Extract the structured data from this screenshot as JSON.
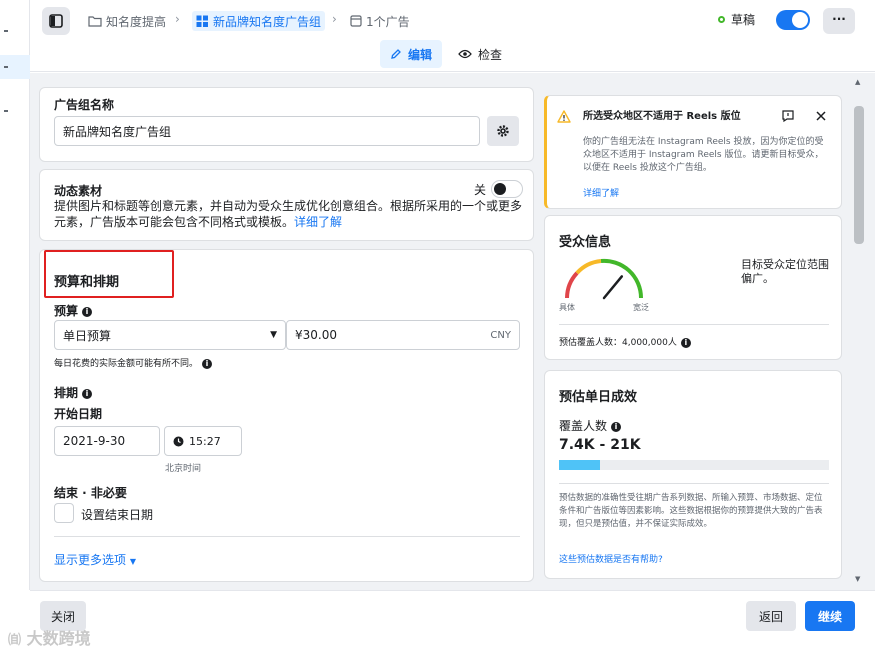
{
  "breadcrumb": {
    "campaign": "知名度提高",
    "adset": "新品牌知名度广告组",
    "ads": "1个广告"
  },
  "status": {
    "draft_label": "草稿"
  },
  "more_label": "···",
  "tabs": {
    "edit": "编辑",
    "review": "检查"
  },
  "adset_name": {
    "label": "广告组名称",
    "value": "新品牌知名度广告组"
  },
  "dynamic_creative": {
    "title": "动态素材",
    "toggle_label": "关",
    "description": "提供图片和标题等创意元素，并自动为受众生成优化创意组合。根据所采用的一个或更多元素，广告版本可能会包含不同格式或模板。",
    "learn_more": "详细了解"
  },
  "budget_schedule": {
    "section_title": "预算和排期",
    "budget_label": "预算",
    "budget_type": "单日预算",
    "budget_amount": "¥30.00",
    "currency": "CNY",
    "budget_note": "每日花费的实际金额可能有所不同。",
    "schedule_label": "排期",
    "start_date_label": "开始日期",
    "start_date": "2021-9-30",
    "start_time": "15:27",
    "timezone": "北京时间",
    "end_label": "结束 · 非必要",
    "end_checkbox": "设置结束日期",
    "show_more": "显示更多选项"
  },
  "warning": {
    "title": "所选受众地区不适用于 Reels 版位",
    "body": "你的广告组无法在 Instagram Reels 投放，因为你定位的受众地区不适用于 Instagram Reels 版位。请更新目标受众，以便在 Reels 投放这个广告组。",
    "link": "详细了解"
  },
  "audience": {
    "title": "受众信息",
    "gauge_left": "具体",
    "gauge_right": "宽泛",
    "gauge_level": 0.72,
    "status": "目标受众定位范围偏广。",
    "reach_label": "预估覆盖人数：",
    "reach_value": "4,000,000人"
  },
  "daily_results": {
    "title": "预估单日成效",
    "reach_label": "覆盖人数",
    "reach_range": "7.4K - 21K",
    "reach_bar": 0.15,
    "disclaimer": "预估数据的准确性受往期广告系列数据、所输入预算、市场数据、定位条件和广告版位等因素影响。这些数据根据你的预算提供大致的广告表现，但只是预估值，并不保证实际成效。",
    "feedback": "这些预估数据是否有帮助?"
  },
  "footer": {
    "close": "关闭",
    "back": "返回",
    "continue": "继续"
  },
  "watermark": "大数跨境",
  "colors": {
    "accent": "#1877f2",
    "warning": "#f7b928",
    "highlight_box": "#e02020",
    "gauge_red": "#e0454a",
    "gauge_yellow": "#f7b928",
    "gauge_green": "#42b72a",
    "progress": "#4fc3f7"
  }
}
